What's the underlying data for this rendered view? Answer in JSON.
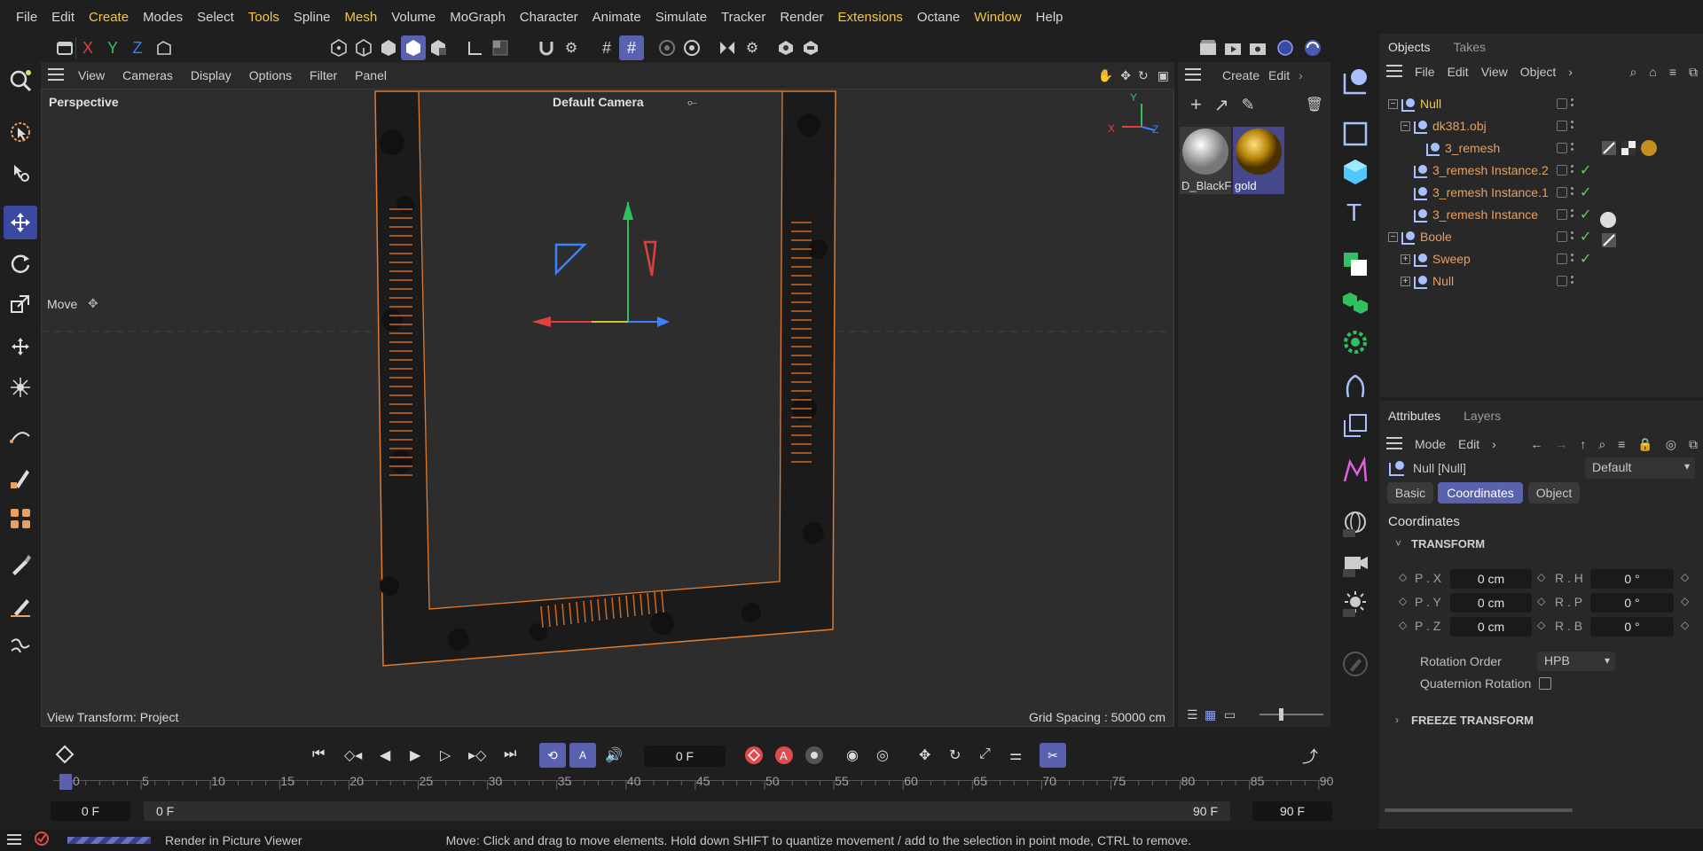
{
  "menu": [
    "File",
    "Edit",
    "Create",
    "Modes",
    "Select",
    "Tools",
    "Spline",
    "Mesh",
    "Volume",
    "MoGraph",
    "Character",
    "Animate",
    "Simulate",
    "Tracker",
    "Render",
    "Extensions",
    "Octane",
    "Window",
    "Help"
  ],
  "menu_highlight": [
    "Create",
    "Tools",
    "Mesh",
    "Extensions",
    "Window"
  ],
  "axis_buttons": {
    "x": "X",
    "y": "Y",
    "z": "Z"
  },
  "viewport": {
    "menu": [
      "View",
      "Cameras",
      "Display",
      "Options",
      "Filter",
      "Panel"
    ],
    "perspective_label": "Perspective",
    "camera_label": "Default Camera",
    "move_label": "Move",
    "view_transform": "View Transform: Project",
    "grid_spacing": "Grid Spacing : 50000 cm",
    "axis_y": "Y",
    "axis_x": "X",
    "axis_z": "Z"
  },
  "materials": {
    "menu": [
      "Create",
      "Edit"
    ],
    "items": [
      {
        "name": "D_BlackF"
      },
      {
        "name": "gold"
      }
    ]
  },
  "objects_panel": {
    "tabs": [
      "Objects",
      "Takes"
    ],
    "menu": [
      "File",
      "Edit",
      "View",
      "Object"
    ],
    "rows": [
      {
        "name": "Null",
        "level": 0,
        "highlight": true,
        "expand": "minus"
      },
      {
        "name": "dk381.obj",
        "level": 1,
        "highlight": false,
        "expand": "minus"
      },
      {
        "name": "3_remesh",
        "level": 2,
        "highlight": false,
        "expand": ""
      },
      {
        "name": "3_remesh Instance.2",
        "level": 1,
        "highlight": false,
        "expand": "",
        "check": true
      },
      {
        "name": "3_remesh Instance.1",
        "level": 1,
        "highlight": false,
        "expand": "",
        "check": true
      },
      {
        "name": "3_remesh Instance",
        "level": 1,
        "highlight": false,
        "expand": "",
        "check": true
      },
      {
        "name": "Boole",
        "level": 0,
        "highlight": false,
        "expand": "minus",
        "check": true
      },
      {
        "name": "Sweep",
        "level": 1,
        "highlight": false,
        "expand": "plus",
        "check": true
      },
      {
        "name": "Null",
        "level": 1,
        "highlight": false,
        "expand": "plus"
      }
    ]
  },
  "attributes": {
    "tabs": [
      "Attributes",
      "Layers"
    ],
    "menu": [
      "Mode",
      "Edit"
    ],
    "object_title": "Null [Null]",
    "preset": "Default",
    "mode_tabs": [
      "Basic",
      "Coordinates",
      "Object"
    ],
    "active_tab": "Coordinates",
    "section_title": "Coordinates",
    "transform_group": "TRANSFORM",
    "fields": {
      "px_label": "P . X",
      "px": "0 cm",
      "py_label": "P . Y",
      "py": "0 cm",
      "pz_label": "P . Z",
      "pz": "0 cm",
      "rh_label": "R . H",
      "rh": "0 °",
      "rp_label": "R . P",
      "rp": "0 °",
      "rb_label": "R . B",
      "rb": "0 °"
    },
    "rotation_order_label": "Rotation Order",
    "rotation_order": "HPB",
    "quaternion_label": "Quaternion Rotation",
    "freeze_group": "FREEZE TRANSFORM"
  },
  "timeline": {
    "current_frame": "0 F",
    "start": "0 F",
    "range_start": "0 F",
    "range_end": "90 F",
    "end": "90 F",
    "ticks": [
      "0",
      "5",
      "10",
      "15",
      "20",
      "25",
      "30",
      "35",
      "40",
      "45",
      "50",
      "55",
      "60",
      "65",
      "70",
      "75",
      "80",
      "85",
      "90"
    ]
  },
  "status": {
    "render_label": "Render in Picture Viewer",
    "hint": "Move: Click and drag to move elements. Hold down SHIFT to quantize movement / add to the selection in point mode, CTRL to remove."
  },
  "colors": {
    "accent": "#5a62b0",
    "orange": "#e8a060",
    "highlight": "#f2c744",
    "axis_x": "#e04040",
    "axis_y": "#30c060",
    "axis_z": "#3a80ff"
  }
}
